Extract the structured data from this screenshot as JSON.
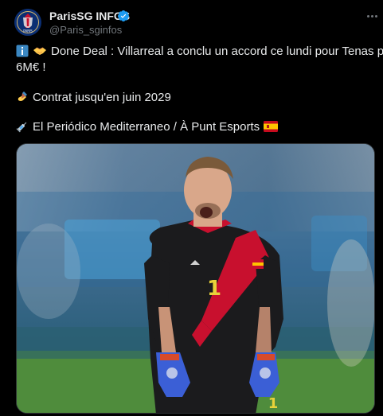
{
  "author": {
    "name": "ParisSG INFOS",
    "handle": "@Paris_sginfos",
    "verified": true,
    "avatar_icon": "psg-crest-icon"
  },
  "tweet": {
    "line1": "Done Deal : Villarreal a conclu un accord ce lundi pour Tenas pour",
    "line2": "6M€ !",
    "line3": "Contrat jusqu'en juin 2029",
    "line4": "El Periódico Mediterraneo / À Punt Esports",
    "emojis": [
      "info-icon",
      "handshake-icon",
      "writing-hand-icon",
      "syringe-icon",
      "spain-flag-icon"
    ]
  },
  "media": {
    "alt": "",
    "jersey_number": "1"
  },
  "colors": {
    "background": "#000000",
    "text": "#e7e9ea",
    "secondary": "#71767b",
    "verified": "#1d9bf0"
  }
}
